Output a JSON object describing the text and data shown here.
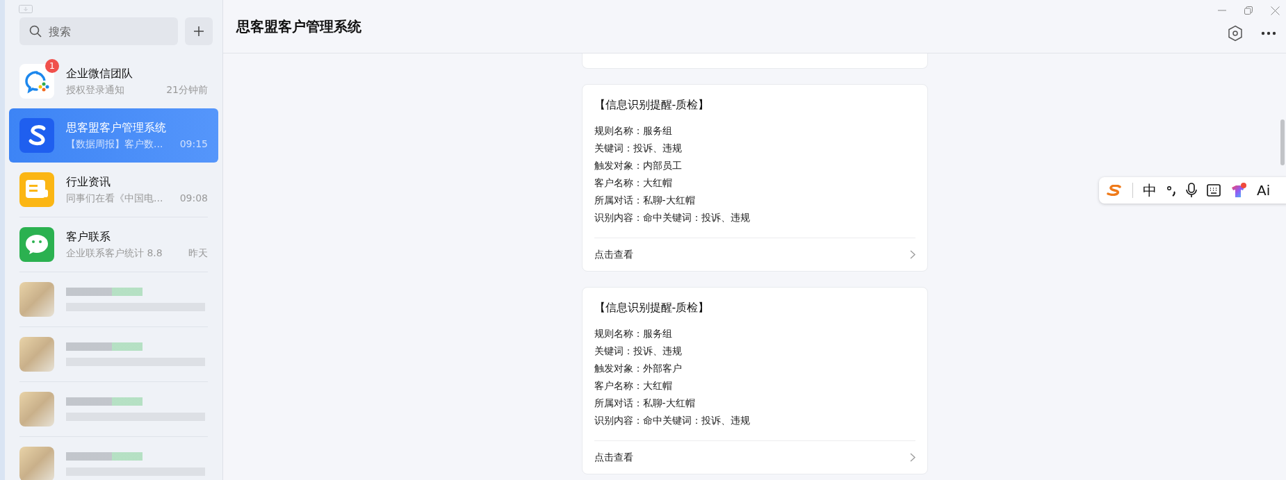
{
  "sidebar": {
    "search": {
      "placeholder": "搜索"
    },
    "chats": [
      {
        "kind": "wecom",
        "name": "企业微信团队",
        "preview": "授权登录通知",
        "time": "21分钟前",
        "badge": "1",
        "selected": false
      },
      {
        "kind": "s-logo",
        "name": "思客盟客户管理系统",
        "preview": "【数据周报】客户数...",
        "time": "09:15",
        "selected": true
      },
      {
        "kind": "news",
        "name": "行业资讯",
        "preview": "同事们在看《中国电...",
        "time": "09:08",
        "selected": false
      },
      {
        "kind": "wechat",
        "name": "客户联系",
        "preview": "企业联系客户统计 8.8",
        "time": "昨天",
        "selected": false
      },
      {
        "kind": "blurred",
        "selected": false
      },
      {
        "kind": "blurred",
        "selected": false
      },
      {
        "kind": "blurred",
        "selected": false
      },
      {
        "kind": "blurred",
        "selected": false
      }
    ]
  },
  "main": {
    "title": "思客盟客户管理系统",
    "cards": [
      {
        "title": "【信息识别提醒-质检】",
        "fields": [
          "规则名称：服务组",
          "关键词：投诉、违规",
          "触发对象：内部员工",
          "客户名称：大红帽",
          "所属对话：私聊-大红帽",
          "识别内容：命中关键词：投诉、违规"
        ],
        "link": "点击查看"
      },
      {
        "title": "【信息识别提醒-质检】",
        "fields": [
          "规则名称：服务组",
          "关键词：投诉、违规",
          "触发对象：外部客户",
          "客户名称：大红帽",
          "所属对话：私聊-大红帽",
          "识别内容：命中关键词：投诉、违规"
        ],
        "link": "点击查看"
      }
    ]
  },
  "ime": {
    "mode": "中",
    "ai": "Ai"
  }
}
